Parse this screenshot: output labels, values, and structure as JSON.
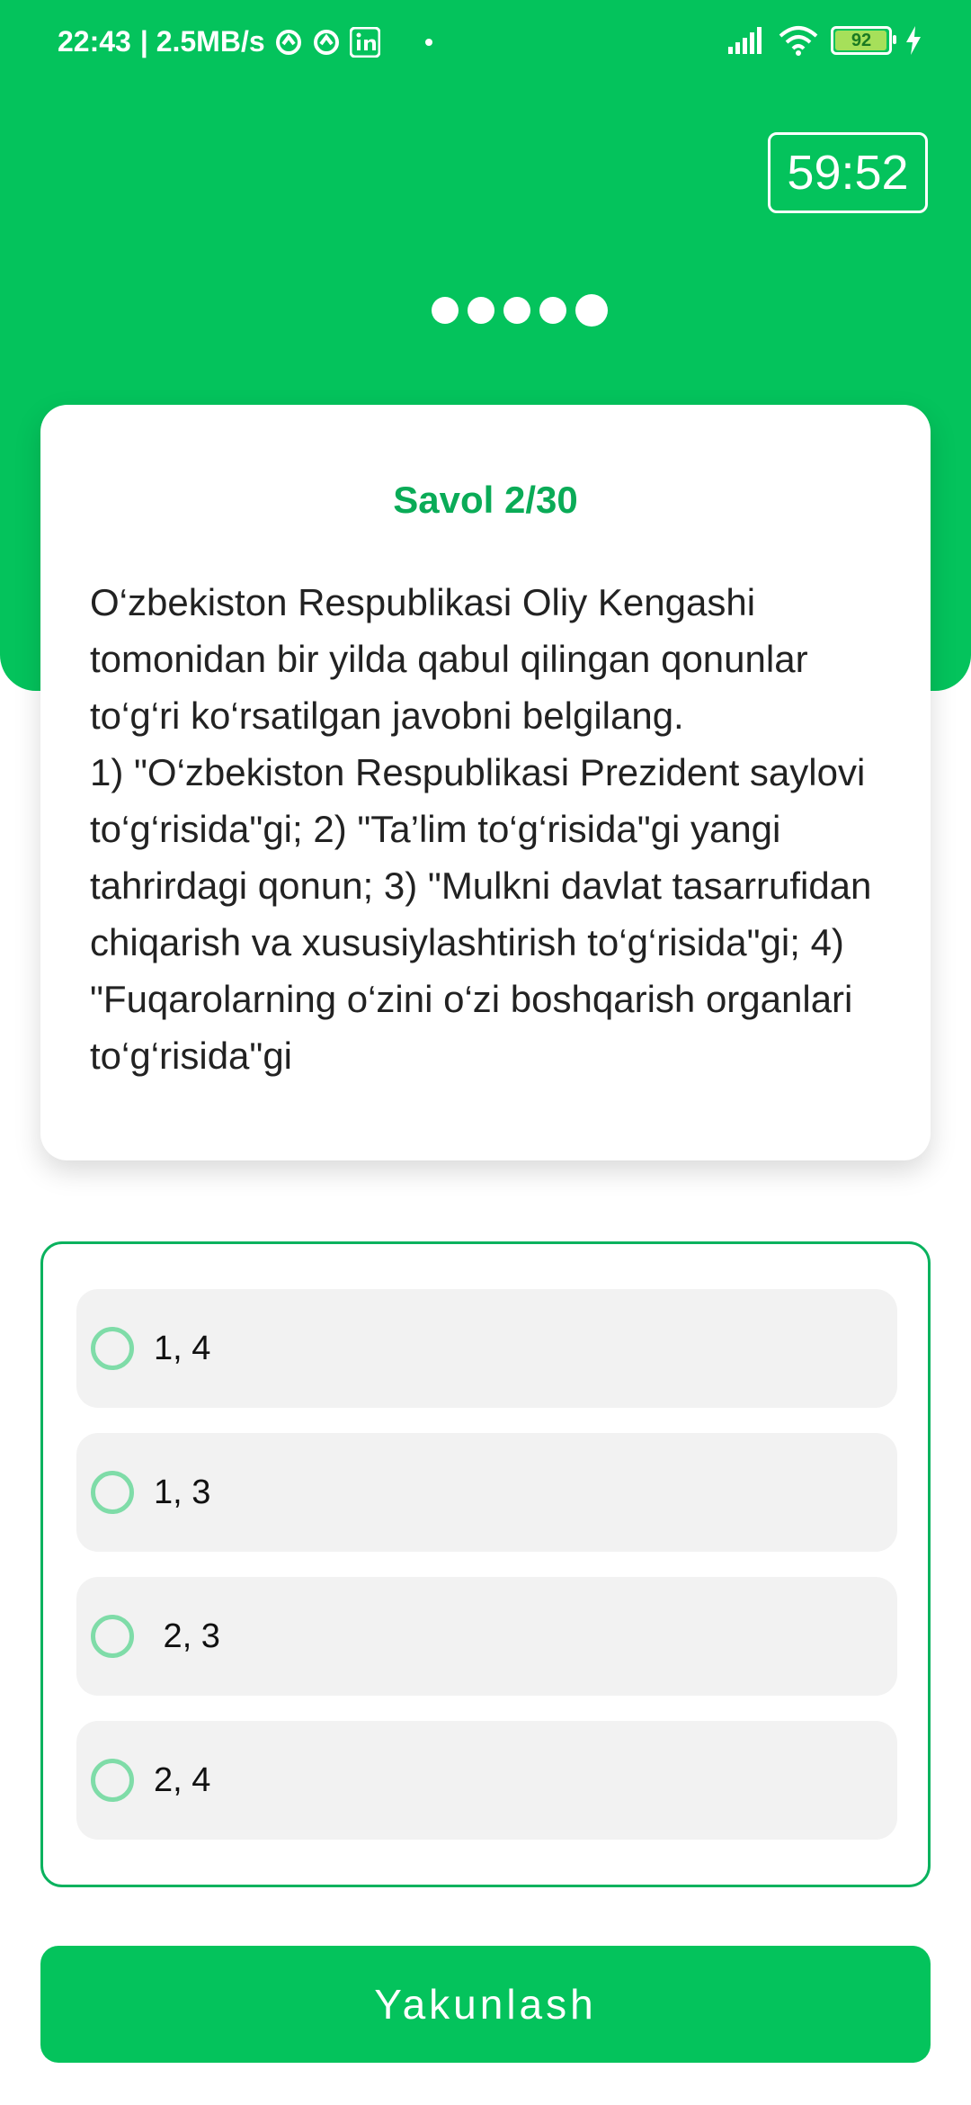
{
  "status_bar": {
    "time": "22:43",
    "speed": "| 2.5MB/s",
    "battery": "92",
    "icons": [
      "vpn-icon",
      "vpn-icon",
      "linkedin-icon",
      "signal-icon",
      "wifi-icon",
      "battery-icon",
      "charging-icon"
    ]
  },
  "timer": "59:52",
  "progress": {
    "dots": 5,
    "active_index": 4
  },
  "question": {
    "number": "Savol 2/30",
    "text": "O‘zbekiston Respublikasi Oliy Kengashi tomonidan bir yilda qabul qilingan qonunlar to‘g‘ri ko‘rsatilgan javobni belgilang.\n1) \"O‘zbekiston Respublikasi Prezident saylovi to‘g‘risida\"gi; 2) \"Ta’lim to‘g‘risida\"gi yangi tahrirdagi qonun; 3) \"Mulkni davlat tasarrufidan chiqarish va xususiylashtirish to‘g‘risida\"gi; 4) \"Fuqarolarning o‘zini o‘zi boshqarish organlari to‘g‘risida\"gi"
  },
  "options": [
    {
      "label": "1, 4"
    },
    {
      "label": "1, 3"
    },
    {
      "label": " 2, 3"
    },
    {
      "label": "2, 4"
    }
  ],
  "finish_button": "Yakunlash",
  "colors": {
    "primary": "#04c35c",
    "accent_text": "#0aab57",
    "radio": "#7fdca8",
    "option_bg": "#f2f2f2"
  }
}
